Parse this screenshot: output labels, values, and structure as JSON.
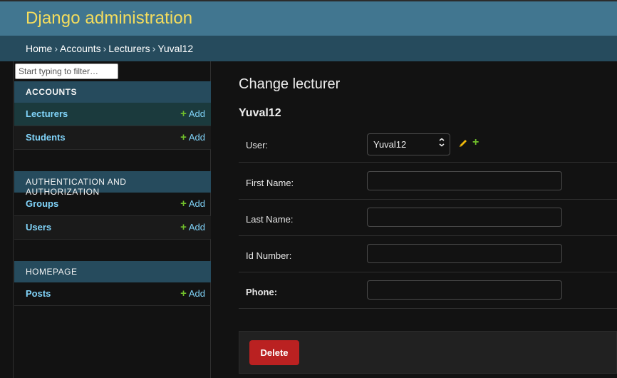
{
  "header": {
    "brand": "Django administration"
  },
  "breadcrumbs": [
    "Home",
    "Accounts",
    "Lecturers",
    "Yuval12"
  ],
  "sidebar": {
    "filter_placeholder": "Start typing to filter…",
    "modules": [
      {
        "caption": "ACCOUNTS",
        "models": [
          {
            "name": "Lecturers",
            "add": "Add"
          },
          {
            "name": "Students",
            "add": "Add"
          }
        ]
      },
      {
        "caption": "AUTHENTICATION AND AUTHORIZATION",
        "models": [
          {
            "name": "Groups",
            "add": "Add"
          },
          {
            "name": "Users",
            "add": "Add"
          }
        ]
      },
      {
        "caption": "HOMEPAGE",
        "models": [
          {
            "name": "Posts",
            "add": "Add"
          }
        ]
      }
    ]
  },
  "main": {
    "title": "Change lecturer",
    "object_name": "Yuval12",
    "fields": [
      {
        "label": "User:",
        "value": "Yuval12",
        "type": "select"
      },
      {
        "label": "First Name:",
        "value": "",
        "type": "text"
      },
      {
        "label": "Last Name:",
        "value": "",
        "type": "text"
      },
      {
        "label": "Id Number:",
        "value": "",
        "type": "text"
      },
      {
        "label": "Phone:",
        "value": "",
        "type": "text"
      }
    ],
    "delete_label": "Delete"
  },
  "colors": {
    "header_bg": "#417690",
    "brand": "#f5dd5d",
    "breadcrumb_bg": "#264b5d",
    "link": "#81d4fa",
    "add_plus": "#70bf2b",
    "delete": "#ba2121"
  },
  "icons": {
    "add": "plus-icon",
    "change_related": "pencil-icon",
    "add_related": "plus-icon",
    "select_arrow": "chevron-down-icon"
  }
}
